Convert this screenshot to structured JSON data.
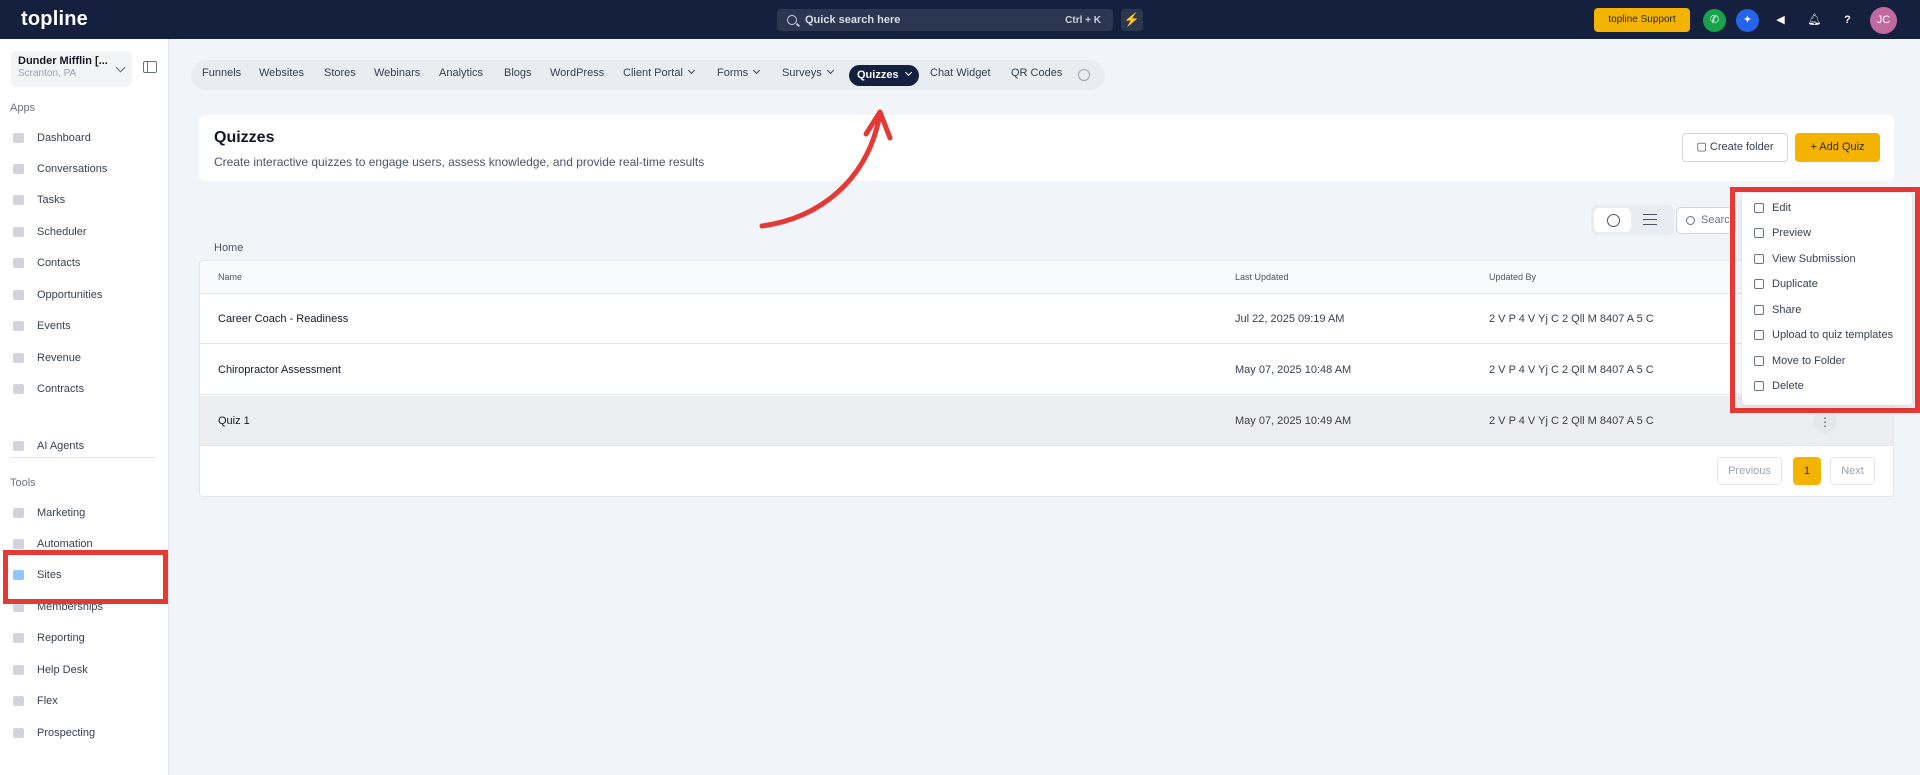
{
  "topbar": {
    "logo": "topline",
    "search_placeholder": "Quick search here",
    "search_shortcut": "Ctrl + K",
    "support_label": "topline Support",
    "avatar_initials": "JC"
  },
  "sidebar": {
    "account_name": "Dunder Mifflin [...",
    "account_location": "Scranton, PA",
    "apps_label": "Apps",
    "tools_label": "Tools",
    "apps": [
      "Dashboard",
      "Conversations",
      "Tasks",
      "Scheduler",
      "Contacts",
      "Opportunities",
      "Events",
      "Revenue",
      "Contracts"
    ],
    "ai_agents": "AI Agents",
    "tools": [
      "Marketing",
      "Automation",
      "Sites",
      "Memberships",
      "Reporting",
      "Help Desk",
      "Flex",
      "Prospecting"
    ]
  },
  "tabs": {
    "items": [
      "Funnels",
      "Websites",
      "Stores",
      "Webinars",
      "Analytics",
      "Blogs",
      "WordPress",
      "Client Portal",
      "Forms",
      "Surveys",
      "Chat Widget",
      "QR Codes"
    ],
    "active": "Quizzes"
  },
  "header": {
    "title": "Quizzes",
    "subtitle": "Create interactive quizzes to engage users, assess knowledge, and provide real-time results",
    "create_folder": "Create folder",
    "add_quiz": "+ Add Quiz"
  },
  "toolbar": {
    "search_placeholder": "Search"
  },
  "breadcrumb": "Home",
  "table": {
    "columns": [
      "Name",
      "Last Updated",
      "Updated By"
    ],
    "rows": [
      {
        "name": "Career Coach - Readiness",
        "updated": "Jul 22, 2025 09:19 AM",
        "by": "2 V P 4 V Yj C 2 Qll M 8407 A 5 C"
      },
      {
        "name": "Chiropractor Assessment",
        "updated": "May 07, 2025 10:48 AM",
        "by": "2 V P 4 V Yj C 2 Qll M 8407 A 5 C"
      },
      {
        "name": "Quiz 1",
        "updated": "May 07, 2025 10:49 AM",
        "by": "2 V P 4 V Yj C 2 Qll M 8407 A 5 C"
      }
    ]
  },
  "pagination": {
    "previous": "Previous",
    "page": "1",
    "next": "Next"
  },
  "menu": [
    "Edit",
    "Preview",
    "View Submission",
    "Duplicate",
    "Share",
    "Upload to quiz templates",
    "Move to Folder",
    "Delete"
  ],
  "colors": {
    "accent": "#f5b301",
    "navy": "#14203d",
    "highlight": "#e53935"
  }
}
